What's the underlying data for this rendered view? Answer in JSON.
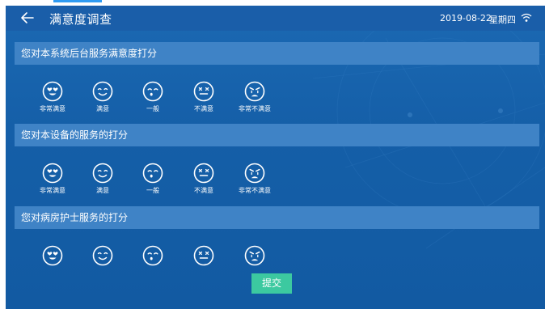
{
  "header": {
    "title": "满意度调查",
    "date": "2019-08-22",
    "weekday": "星期四"
  },
  "sections": [
    {
      "question": "您对本系统后台服务满意度打分",
      "options": [
        {
          "label": "非常满意",
          "icon": "very-satisfied-face-icon"
        },
        {
          "label": "满意",
          "icon": "satisfied-face-icon"
        },
        {
          "label": "一般",
          "icon": "neutral-face-icon"
        },
        {
          "label": "不满意",
          "icon": "dissatisfied-face-icon"
        },
        {
          "label": "非常不满意",
          "icon": "very-dissatisfied-face-icon"
        }
      ]
    },
    {
      "question": "您对本设备的服务的打分",
      "options": [
        {
          "label": "非常满意",
          "icon": "very-satisfied-face-icon"
        },
        {
          "label": "满意",
          "icon": "satisfied-face-icon"
        },
        {
          "label": "一般",
          "icon": "neutral-face-icon"
        },
        {
          "label": "不满意",
          "icon": "dissatisfied-face-icon"
        },
        {
          "label": "非常不满意",
          "icon": "very-dissatisfied-face-icon"
        }
      ]
    },
    {
      "question": "您对病房护士服务的打分",
      "options": [
        {
          "label": "",
          "icon": "very-satisfied-face-icon"
        },
        {
          "label": "",
          "icon": "satisfied-face-icon"
        },
        {
          "label": "",
          "icon": "neutral-face-icon"
        },
        {
          "label": "",
          "icon": "dissatisfied-face-icon"
        },
        {
          "label": "",
          "icon": "very-dissatisfied-face-icon"
        }
      ]
    }
  ],
  "submit_label": "提交",
  "colors": {
    "background": "#155fa8",
    "header": "#1a5ea9",
    "section_bar": "#3f83c6",
    "submit": "#3cc9a0",
    "text": "#ffffff"
  }
}
